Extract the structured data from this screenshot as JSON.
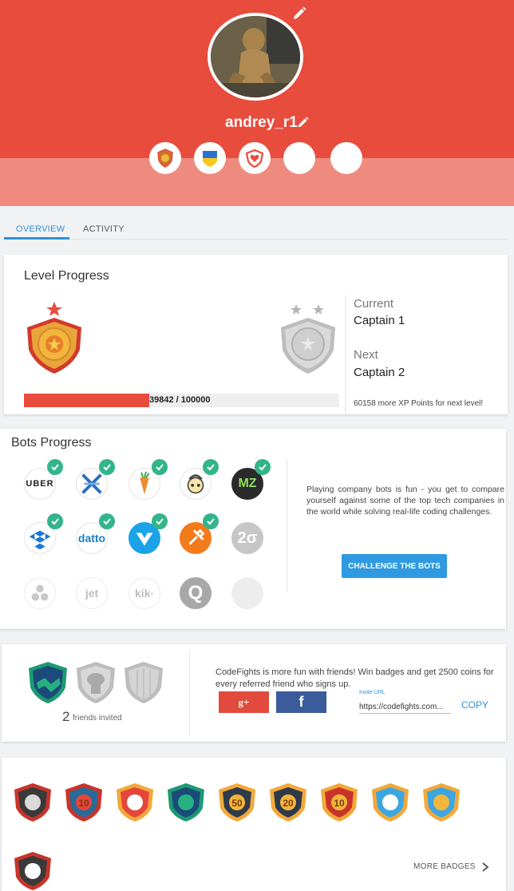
{
  "profile": {
    "username": "andrey_r1",
    "header_badges": [
      "fire-badge-icon",
      "ukraine-flag-icon",
      "heart-badge-icon",
      "empty-slot",
      "empty-slot"
    ]
  },
  "tabs": [
    {
      "label": "OVERVIEW",
      "active": true
    },
    {
      "label": "ACTIVITY",
      "active": false
    }
  ],
  "level": {
    "title": "Level Progress",
    "current_label": "Current",
    "current_value": "Captain 1",
    "next_label": "Next",
    "next_value": "Captain 2",
    "xp_text": "39842 / 100000",
    "xp_note": "60158 more XP Points for next level!",
    "xp_fraction": 0.39842
  },
  "bots": {
    "title": "Bots Progress",
    "description": "Playing company bots is fun - you get to compare yourself against some of the top tech companies in the world while solving real-life coding challenges.",
    "button_label": "CHALLENGE THE BOTS",
    "items": [
      {
        "label": "UBER",
        "done": true
      },
      {
        "label": "",
        "done": true
      },
      {
        "label": "",
        "done": true
      },
      {
        "label": "",
        "done": true
      },
      {
        "label": "MZ",
        "done": true
      },
      {
        "label": "",
        "done": true
      },
      {
        "label": "datto",
        "done": true
      },
      {
        "label": "",
        "done": true
      },
      {
        "label": "",
        "done": true
      },
      {
        "label": "2σ",
        "done": false
      },
      {
        "label": "",
        "done": false
      },
      {
        "label": "jet",
        "done": false
      },
      {
        "label": "kik·",
        "done": false
      },
      {
        "label": "Q",
        "done": false
      },
      {
        "label": "",
        "done": false
      }
    ]
  },
  "friends": {
    "count": "2",
    "count_label": "friends invited",
    "text": "CodeFights is more fun with friends! Win badges and get 2500 coins for every referred friend who signs up.",
    "gplus_label": "g+",
    "fb_label": "f",
    "invite_label": "Invite URL",
    "invite_url": "https://codefights.com...",
    "copy_label": "COPY"
  },
  "badges": {
    "more_label": "MORE BADGES",
    "items": [
      {
        "icon": "mask-badge-icon",
        "text": ""
      },
      {
        "icon": "ten-record-badge-icon",
        "text": "10"
      },
      {
        "icon": "check-badge-icon",
        "text": ""
      },
      {
        "icon": "handshake-badge-icon",
        "text": ""
      },
      {
        "icon": "fifty-badge-icon",
        "text": "50"
      },
      {
        "icon": "twenty-badge-icon",
        "text": "20"
      },
      {
        "icon": "ten-badge-icon",
        "text": "10"
      },
      {
        "icon": "robot-badge-icon",
        "text": ""
      },
      {
        "icon": "star-check-badge-icon",
        "text": ""
      },
      {
        "icon": "envelope-badge-icon",
        "text": ""
      }
    ]
  },
  "colors": {
    "accent": "#e84c3d",
    "link": "#2f8fd8",
    "check": "#33b48b",
    "button": "#2f9ae1"
  }
}
